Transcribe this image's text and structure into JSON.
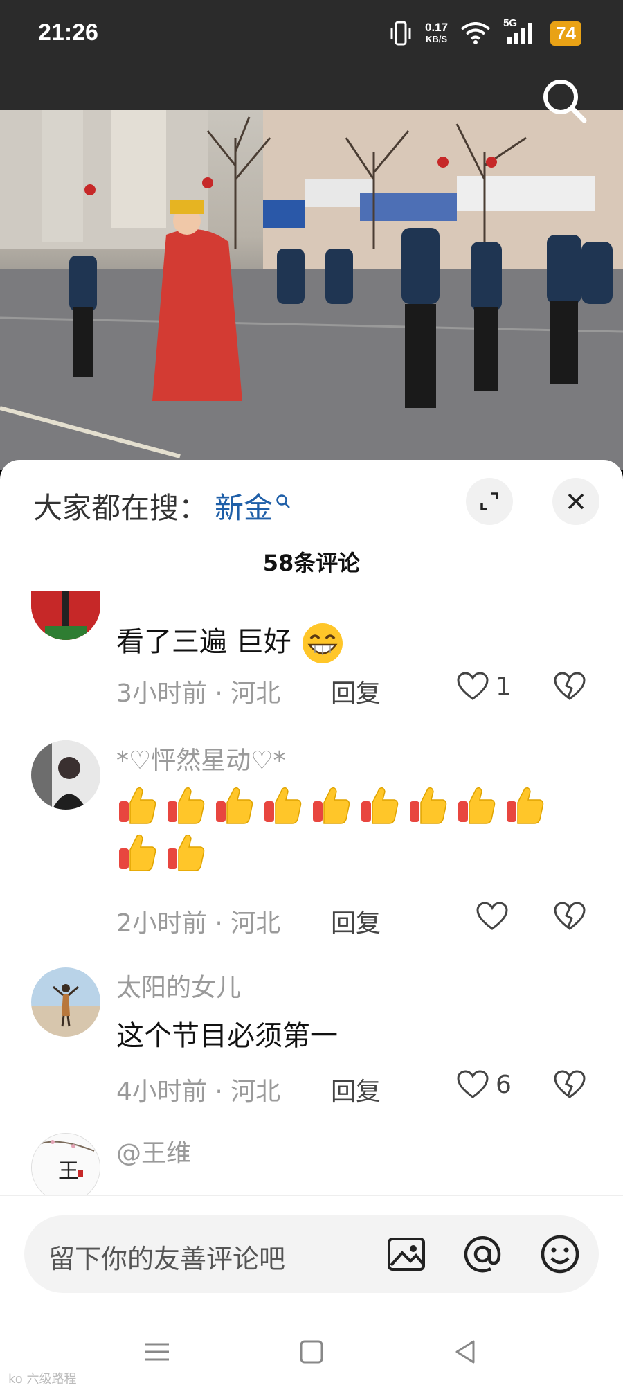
{
  "status_bar": {
    "time": "21:26",
    "speed_value": "0.17",
    "speed_unit": "KB/S",
    "network": "5G",
    "battery": "74"
  },
  "icons": {
    "search": "search-icon",
    "expand": "expand-icon",
    "close": "close-icon",
    "image": "image-icon",
    "at": "at-icon",
    "emoji": "emoji-icon"
  },
  "sheet": {
    "hot_search_label": "大家都在搜：",
    "hot_search_term": "新金",
    "comment_count": "58条评论"
  },
  "comments": [
    {
      "name": "",
      "text": "看了三遍 巨好",
      "meta": "3小时前 · 河北",
      "reply": "回复",
      "likes": "1"
    },
    {
      "name": "*♡怦然星动♡*",
      "thumbs_count": 11,
      "meta": "2小时前 · 河北",
      "reply": "回复",
      "likes": ""
    },
    {
      "name": "太阳的女儿",
      "text": "这个节目必须第一",
      "meta": "4小时前 · 河北",
      "reply": "回复",
      "likes": "6"
    },
    {
      "name": "@王维",
      "avatar_char": "王"
    }
  ],
  "input": {
    "placeholder": "留下你的友善评论吧"
  },
  "watermark": "ko 六级路程",
  "colors": {
    "accent_link": "#1f5fa8",
    "battery": "#e9a215",
    "status_bar_bg": "#2b2b2b"
  }
}
